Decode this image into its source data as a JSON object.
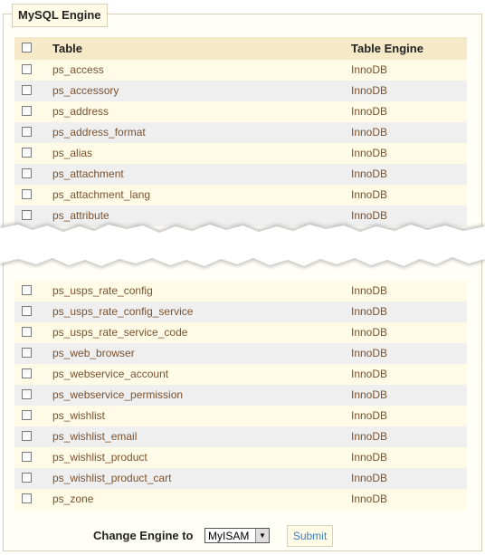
{
  "fieldset": {
    "legend": "MySQL Engine"
  },
  "table": {
    "headers": {
      "table": "Table",
      "engine": "Table Engine"
    },
    "rows_top": [
      {
        "name": "ps_access",
        "engine": "InnoDB"
      },
      {
        "name": "ps_accessory",
        "engine": "InnoDB"
      },
      {
        "name": "ps_address",
        "engine": "InnoDB"
      },
      {
        "name": "ps_address_format",
        "engine": "InnoDB"
      },
      {
        "name": "ps_alias",
        "engine": "InnoDB"
      },
      {
        "name": "ps_attachment",
        "engine": "InnoDB"
      },
      {
        "name": "ps_attachment_lang",
        "engine": "InnoDB"
      },
      {
        "name": "ps_attribute",
        "engine": "InnoDB"
      }
    ],
    "rows_bottom": [
      {
        "name": "ps_usps_rate_config",
        "engine": "InnoDB"
      },
      {
        "name": "ps_usps_rate_config_service",
        "engine": "InnoDB"
      },
      {
        "name": "ps_usps_rate_service_code",
        "engine": "InnoDB"
      },
      {
        "name": "ps_web_browser",
        "engine": "InnoDB"
      },
      {
        "name": "ps_webservice_account",
        "engine": "InnoDB"
      },
      {
        "name": "ps_webservice_permission",
        "engine": "InnoDB"
      },
      {
        "name": "ps_wishlist",
        "engine": "InnoDB"
      },
      {
        "name": "ps_wishlist_email",
        "engine": "InnoDB"
      },
      {
        "name": "ps_wishlist_product",
        "engine": "InnoDB"
      },
      {
        "name": "ps_wishlist_product_cart",
        "engine": "InnoDB"
      },
      {
        "name": "ps_zone",
        "engine": "InnoDB"
      }
    ]
  },
  "footer": {
    "change_label": "Change Engine to",
    "engine_select": {
      "selected": "MyISAM"
    },
    "submit_label": "Submit"
  }
}
